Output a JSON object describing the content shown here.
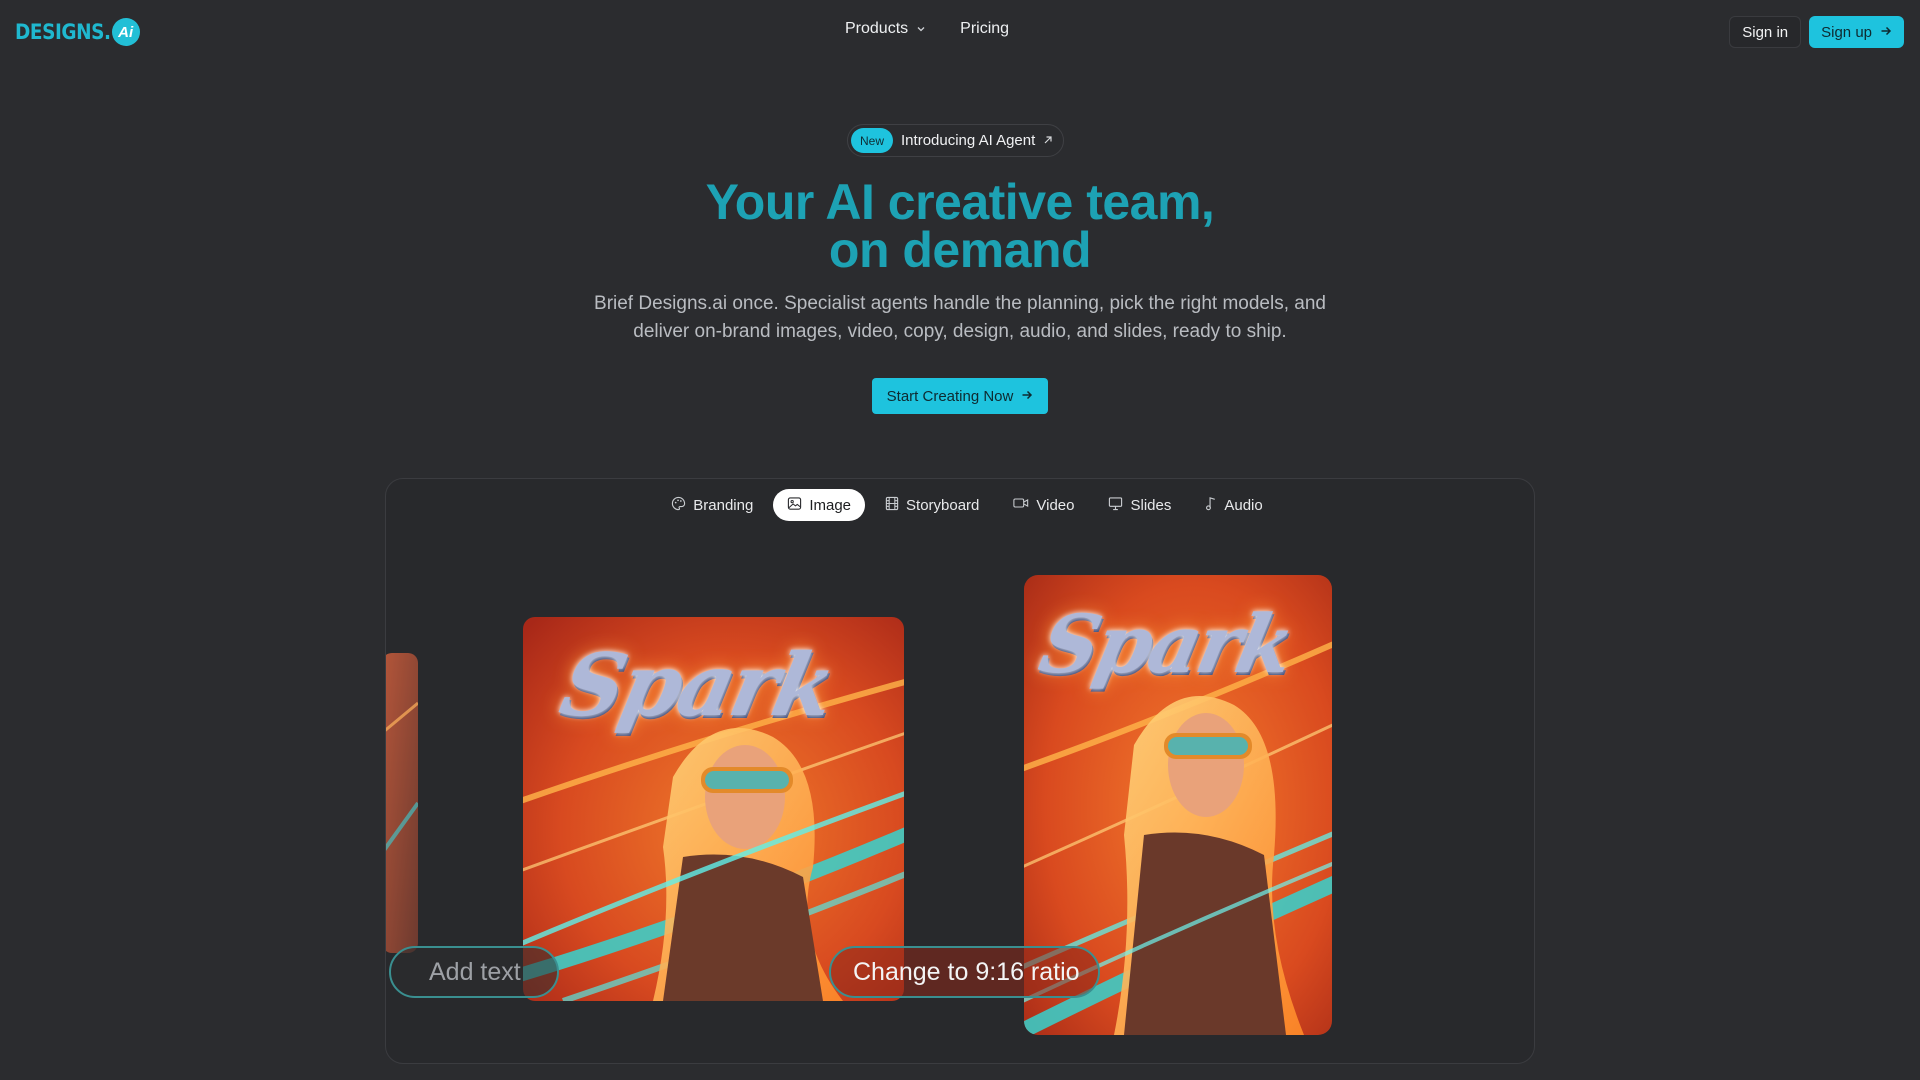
{
  "brand": {
    "logo_text": "DESIGNS.",
    "logo_badge": "Ai",
    "accent": "#1ec3de"
  },
  "nav": {
    "products": "Products",
    "pricing": "Pricing",
    "sign_in": "Sign in",
    "sign_up": "Sign up"
  },
  "hero": {
    "badge": "New",
    "announcement": "Introducing AI Agent",
    "title_line1": "Your AI creative team,",
    "title_line2": "on demand",
    "subtitle_line1": "Brief Designs.ai once. Specialist agents handle the planning, pick the right models, and",
    "subtitle_line2": "deliver on-brand images, video, copy, design, audio, and slides, ready to ship.",
    "cta": "Start Creating Now"
  },
  "showcase": {
    "tabs": [
      {
        "label": "Branding",
        "icon": "palette-icon",
        "active": false
      },
      {
        "label": "Image",
        "icon": "image-icon",
        "active": true
      },
      {
        "label": "Storyboard",
        "icon": "film-icon",
        "active": false
      },
      {
        "label": "Video",
        "icon": "video-icon",
        "active": false
      },
      {
        "label": "Slides",
        "icon": "presentation-icon",
        "active": false
      },
      {
        "label": "Audio",
        "icon": "music-note-icon",
        "active": false
      }
    ],
    "poster_word": "Spark",
    "chip_add_text": "Add text",
    "chip_ratio": "Change to 9:16 ratio"
  }
}
